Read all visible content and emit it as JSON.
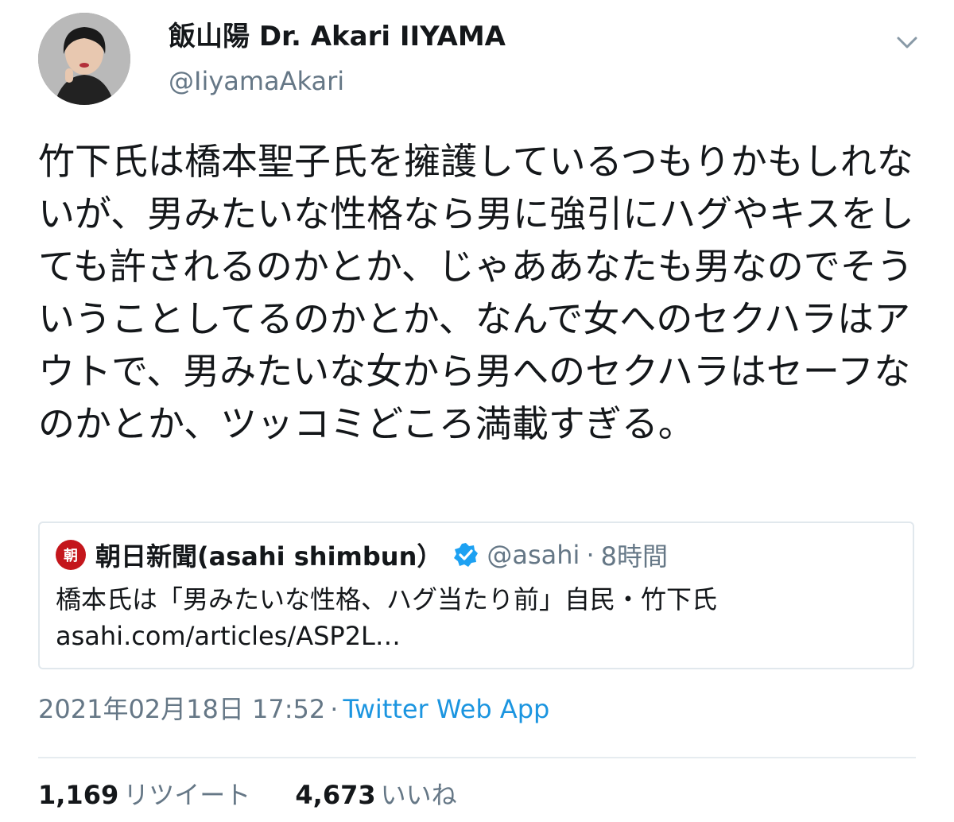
{
  "tweet": {
    "author": {
      "display_name": "飯山陽 Dr. Akari IIYAMA",
      "handle": "@IiyamaAkari"
    },
    "text": "竹下氏は橋本聖子氏を擁護しているつもりかもしれないが、男みたいな性格なら男に強引にハグやキスをしても許されるのかとか、じゃああなたも男なのでそういうことしてるのかとか、なんで女へのセクハラはアウトで、男みたいな女から男へのセクハラはセーフなのかとか、ツッコミどころ満載すぎる。",
    "quoted": {
      "avatar_text": "朝",
      "name": "朝日新聞(asahi shimbun）",
      "handle": "@asahi",
      "separator": "·",
      "time": "8時間",
      "text": "橋本氏は「男みたいな性格、ハグ当たり前」自民・竹下氏",
      "link": "asahi.com/articles/ASP2L…"
    },
    "timestamp": "2021年02月18日 17:52",
    "separator": "·",
    "source": "Twitter Web App",
    "stats": {
      "retweets_count": "1,169",
      "retweets_label": "リツイート",
      "likes_count": "4,673",
      "likes_label": "いいね"
    }
  },
  "colors": {
    "text": "#14171a",
    "secondary": "#657786",
    "link": "#1b95e0",
    "verified": "#1da1f2",
    "asahi_red": "#c4161c",
    "border": "#e1e8ed"
  },
  "icons": {
    "caret": "chevron-down-icon",
    "verified": "verified-badge-icon"
  }
}
